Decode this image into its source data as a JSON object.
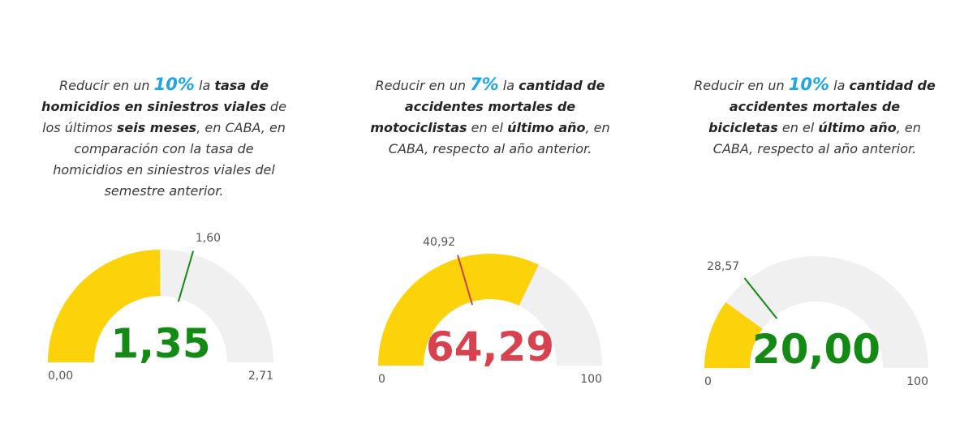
{
  "colors": {
    "fill": "#fcd20a",
    "track": "#f0f0f0",
    "accent_pct": "#1ea7e4",
    "good": "#138a13",
    "bad": "#d7424e",
    "target_good": "#138a13",
    "target_bad": "#c8434a"
  },
  "chart_data": [
    {
      "type": "gauge",
      "description": {
        "pre": "Reducir en un ",
        "pct": "10%",
        "mid1": " la ",
        "bold1": "tasa de homicidios en siniestros viales",
        "mid2": " de los últimos ",
        "bold2": "seis meses",
        "post": ", en CABA, en comparación con la tasa de homicidios en siniestros viales del semestre anterior."
      },
      "value": 1.35,
      "value_label": "1,35",
      "min": 0,
      "min_label": "0,00",
      "max": 2.71,
      "max_label": "2,71",
      "target": 1.6,
      "target_label": "1,60",
      "value_color": "#138a13",
      "target_color": "#138a13"
    },
    {
      "type": "gauge",
      "description": {
        "pre": "Reducir en un ",
        "pct": "7%",
        "mid1": " la ",
        "bold1": "cantidad de accidentes mortales de motociclistas",
        "mid2": " en el ",
        "bold2": "último año",
        "post": ", en CABA, respecto al año anterior."
      },
      "value": 64.29,
      "value_label": "64,29",
      "min": 0,
      "min_label": "0",
      "max": 100,
      "max_label": "100",
      "target": 40.92,
      "target_label": "40,92",
      "value_color": "#d7424e",
      "target_color": "#c8434a"
    },
    {
      "type": "gauge",
      "description": {
        "pre": "Reducir en un ",
        "pct": "10%",
        "mid1": " la ",
        "bold1": "cantidad de accidentes mortales de bicicletas",
        "mid2": " en el ",
        "bold2": "último año",
        "post": ", en CABA, respecto al año anterior."
      },
      "value": 20.0,
      "value_label": "20,00",
      "min": 0,
      "min_label": "0",
      "max": 100,
      "max_label": "100",
      "target": 28.57,
      "target_label": "28,57",
      "value_color": "#138a13",
      "target_color": "#138a13"
    }
  ]
}
